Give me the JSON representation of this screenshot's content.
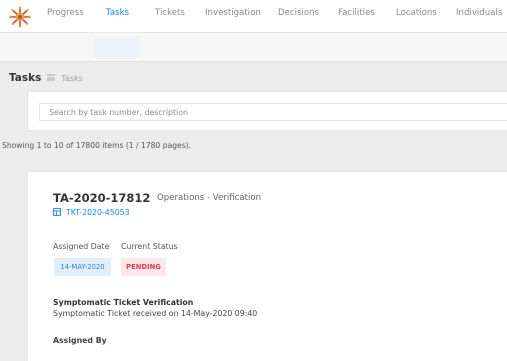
{
  "header": {
    "logo_icon": "virus-logo-icon",
    "brand_color": "#c8463f"
  },
  "nav": {
    "items": [
      {
        "label": "Progress"
      },
      {
        "label": "Tasks"
      },
      {
        "label": "Tickets"
      },
      {
        "label": "Investigation"
      },
      {
        "label": "Decisions"
      },
      {
        "label": "Facilities"
      },
      {
        "label": "Locations"
      },
      {
        "label": "Individuals"
      }
    ],
    "active": "Tasks",
    "active_color": "#1e88e5"
  },
  "breadcrumb": {
    "title": "Tasks",
    "icon": "list-icon",
    "current": "Tasks"
  },
  "search": {
    "placeholder": "Search by task number, description",
    "value": ""
  },
  "results": {
    "summary": "Showing 1 to 10 of 17800 items (1 / 1780 pages)."
  },
  "task": {
    "id": "TA-2020-17812",
    "type": "Operations - Verification",
    "ticket_icon": "ticket-icon",
    "ticket": "TKT-2020-45053",
    "assigned_date_label": "Assigned Date",
    "current_status_label": "Current Status",
    "assigned_date": "14-MAY-2020",
    "status": "PENDING",
    "status_color": "#e53950",
    "title": "Symptomatic Ticket Verification",
    "description": "Symptomatic Ticket received on 14-May-2020 09:40",
    "assigned_by_label": "Assigned By"
  }
}
